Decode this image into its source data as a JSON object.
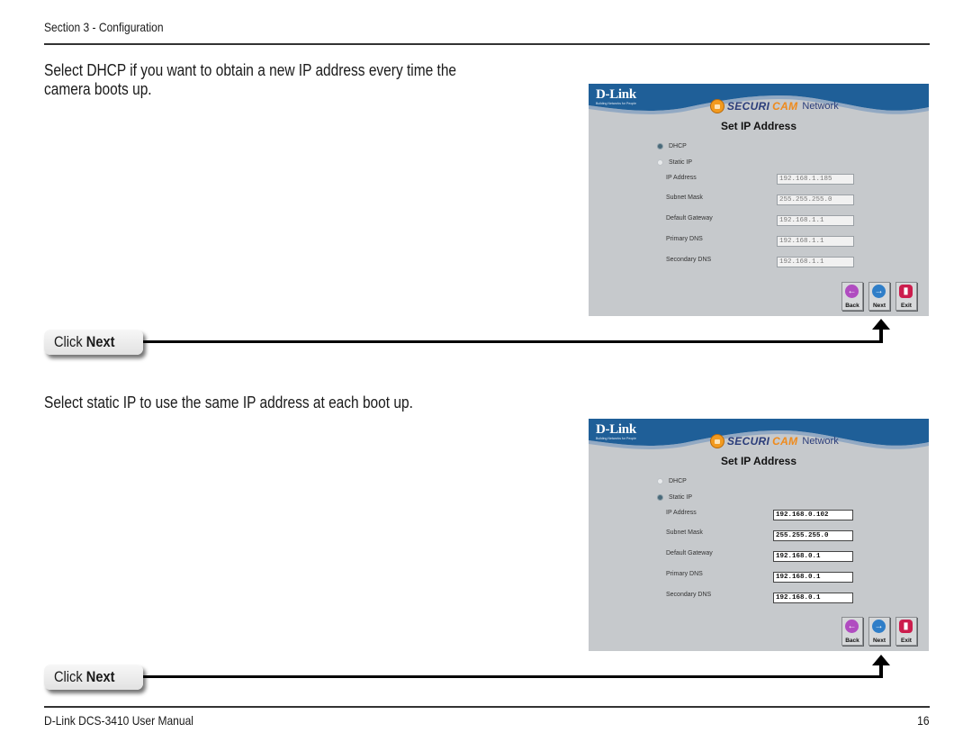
{
  "header": {
    "section": "Section 3 - Configuration"
  },
  "footer": {
    "manual": "D-Link DCS-3410 User Manual",
    "page": "16"
  },
  "steps": [
    {
      "description": "Select DHCP if you want to obtain a new IP address every time the camera boots up.",
      "callout": {
        "prefix": "Click",
        "action": "Next"
      },
      "screenshot": {
        "brand": "D-Link",
        "brand_tagline": "Building Networks for People",
        "product_securi": "SECURI",
        "product_cam": "CAM",
        "product_network": "Network",
        "title": "Set IP Address",
        "options": [
          {
            "label": "DHCP",
            "selected": true
          },
          {
            "label": "Static IP",
            "selected": false
          }
        ],
        "fields": [
          {
            "label": "IP Address",
            "value": "192.168.1.185"
          },
          {
            "label": "Subnet Mask",
            "value": "255.255.255.0"
          },
          {
            "label": "Default Gateway",
            "value": "192.168.1.1"
          },
          {
            "label": "Primary DNS",
            "value": "192.168.1.1"
          },
          {
            "label": "Secondary DNS",
            "value": "192.168.1.1"
          }
        ],
        "fields_enabled": false,
        "buttons": {
          "back": "Back",
          "next": "Next",
          "exit": "Exit"
        }
      }
    },
    {
      "description": "Select static IP to use the same IP address at each boot up.",
      "callout": {
        "prefix": "Click",
        "action": "Next"
      },
      "screenshot": {
        "brand": "D-Link",
        "brand_tagline": "Building Networks for People",
        "product_securi": "SECURI",
        "product_cam": "CAM",
        "product_network": "Network",
        "title": "Set IP Address",
        "options": [
          {
            "label": "DHCP",
            "selected": false
          },
          {
            "label": "Static IP",
            "selected": true
          }
        ],
        "fields": [
          {
            "label": "IP Address",
            "value": "192.168.0.102"
          },
          {
            "label": "Subnet Mask",
            "value": "255.255.255.0"
          },
          {
            "label": "Default Gateway",
            "value": "192.168.0.1"
          },
          {
            "label": "Primary DNS",
            "value": "192.168.0.1"
          },
          {
            "label": "Secondary DNS",
            "value": "192.168.0.1"
          }
        ],
        "fields_enabled": true,
        "buttons": {
          "back": "Back",
          "next": "Next",
          "exit": "Exit"
        }
      }
    }
  ],
  "colors": {
    "banner_blue": "#1f5f98",
    "panel_gray": "#c6c9cc",
    "securi_blue": "#2b3d7a",
    "cam_orange": "#ef8a1b"
  },
  "icons": {
    "lock": "securicam-lock-icon",
    "back": "back-arrow-icon",
    "next": "next-arrow-icon",
    "exit": "exit-door-icon",
    "pointer": "arrow-up-icon"
  }
}
